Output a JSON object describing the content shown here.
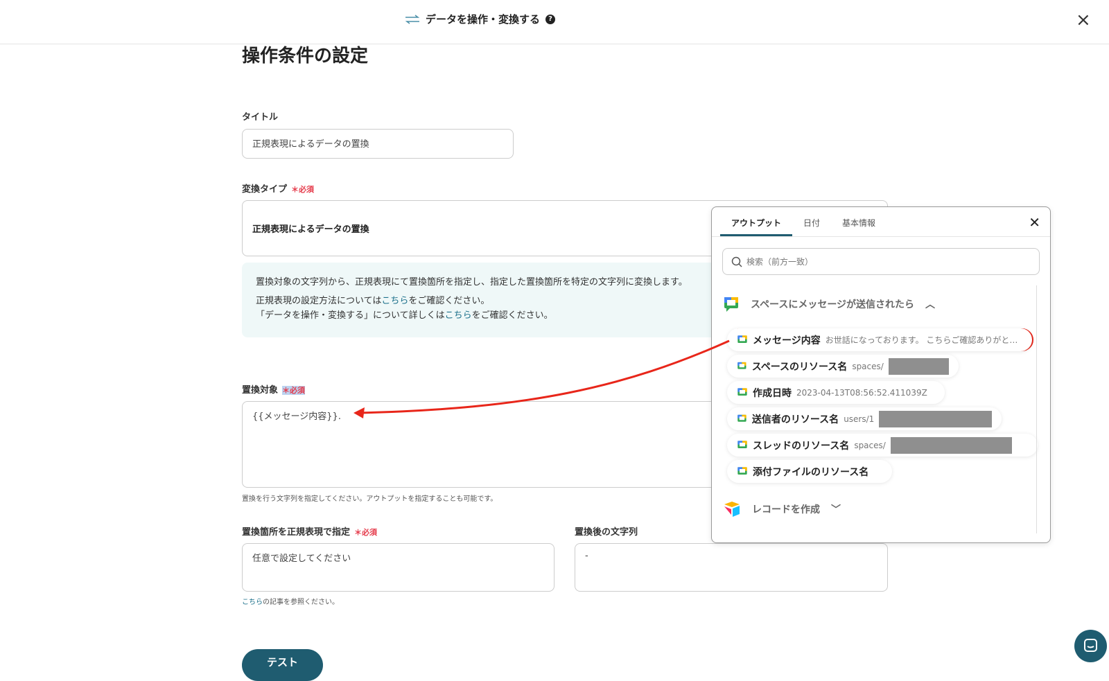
{
  "header": {
    "title": "データを操作・変換する",
    "help_icon": "?",
    "close_icon": "×"
  },
  "page": {
    "heading": "操作条件の設定"
  },
  "form": {
    "title_label": "タイトル",
    "title_value": "正規表現によるデータの置換",
    "type_label": "変換タイプ",
    "required": "＊必須",
    "type_value": "正規表現によるデータの置換",
    "info_line1": "置換対象の文字列から、正規表現にて置換箇所を指定し、指定した置換箇所を特定の文字列に変換します。",
    "info_line2_pre": "正規表現の設定方法については",
    "info_link": "こちら",
    "info_line2_post": "をご確認ください。",
    "info_line3_pre": "「データを操作・変換する」について詳しくは",
    "info_line3_post": "をご確認ください。",
    "target_label": "置換対象",
    "target_value": "{{メッセージ内容}}.",
    "target_hint": "置換を行う文字列を指定してください。アウトプットを指定することも可能です。",
    "regex_label": "置換箇所を正規表現で指定",
    "regex_placeholder": "任意で設定してください",
    "after_label": "置換後の文字列",
    "after_value": "-",
    "regex_hint_link": "こちら",
    "regex_hint_post": "の記事を参照ください。",
    "test_button": "テスト"
  },
  "popup": {
    "tabs": [
      "アウトプット",
      "日付",
      "基本情報"
    ],
    "search_placeholder": "検索（前方一致）",
    "section1": "スペースにメッセージが送信されたら",
    "items": [
      {
        "label": "メッセージ内容",
        "value": "お世話になっております。 こちらご確認ありがと…"
      },
      {
        "label": "スペースのリソース名",
        "value": "spaces/"
      },
      {
        "label": "作成日時",
        "value": "2023-04-13T08:56:52.411039Z"
      },
      {
        "label": "送信者のリソース名",
        "value": "users/1"
      },
      {
        "label": "スレッドのリソース名",
        "value": "spaces/"
      },
      {
        "label": "添付ファイルのリソース名",
        "value": ""
      }
    ],
    "section2": "レコードを作成"
  },
  "colors": {
    "accent": "#1f5c70",
    "required": "#e53b4b",
    "highlight": "#e8261a"
  }
}
